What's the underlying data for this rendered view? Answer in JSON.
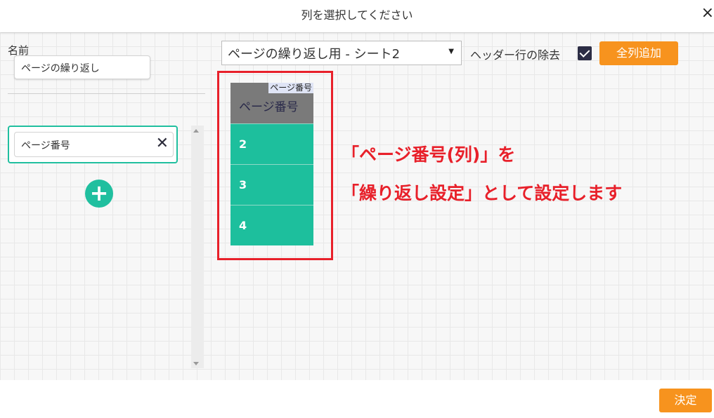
{
  "dialog": {
    "title": "列を選択してください",
    "close_icon": "×"
  },
  "left_panel": {
    "name_label": "名前",
    "name_value": "ページの繰り返し",
    "column_item_value": "ページ番号",
    "clear_icon": "✕",
    "add_icon": "+"
  },
  "toolbar": {
    "sheet_select_value": "ページの繰り返し用 - シート2",
    "select_arrow": "▼",
    "header_remove_label": "ヘッダー行の除去",
    "header_remove_checked": true,
    "add_all_label": "全列追加"
  },
  "preview": {
    "header_tag": "ページ番号",
    "header_title": "ページ番号",
    "rows": [
      "2",
      "3",
      "4"
    ]
  },
  "annotation": {
    "line1": "「ページ番号(列)」を",
    "line2": "「繰り返し設定」として設定します",
    "color": "#e8202a"
  },
  "footer": {
    "ok_label": "決定"
  },
  "colors": {
    "accent_teal": "#20bf9f",
    "button_orange": "#f7931e"
  }
}
